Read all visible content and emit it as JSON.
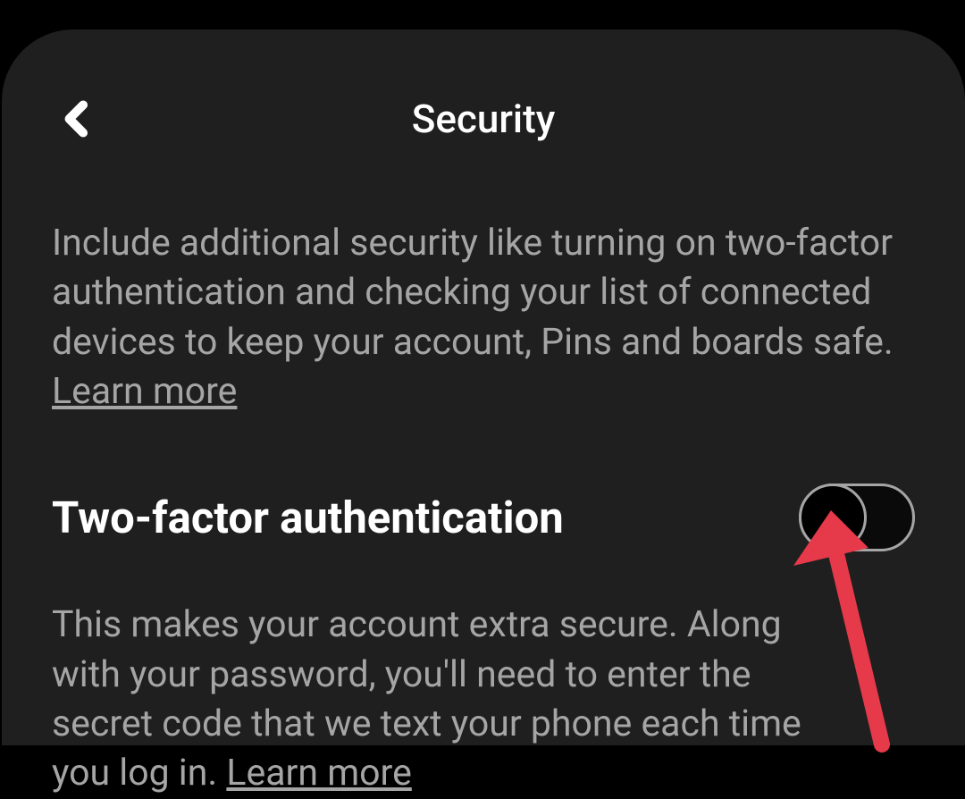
{
  "header": {
    "title": "Security"
  },
  "intro": {
    "text": "Include additional security like turning on two-factor authentication and checking your list of connected devices to keep your account, Pins and boards safe. ",
    "learn_more": "Learn more"
  },
  "twofa": {
    "title": "Two-factor authentication",
    "desc": "This makes your account extra secure. Along with your password, you'll need to enter the secret code that we text your phone each time you log in. ",
    "learn_more": "Learn more",
    "enabled": false
  }
}
